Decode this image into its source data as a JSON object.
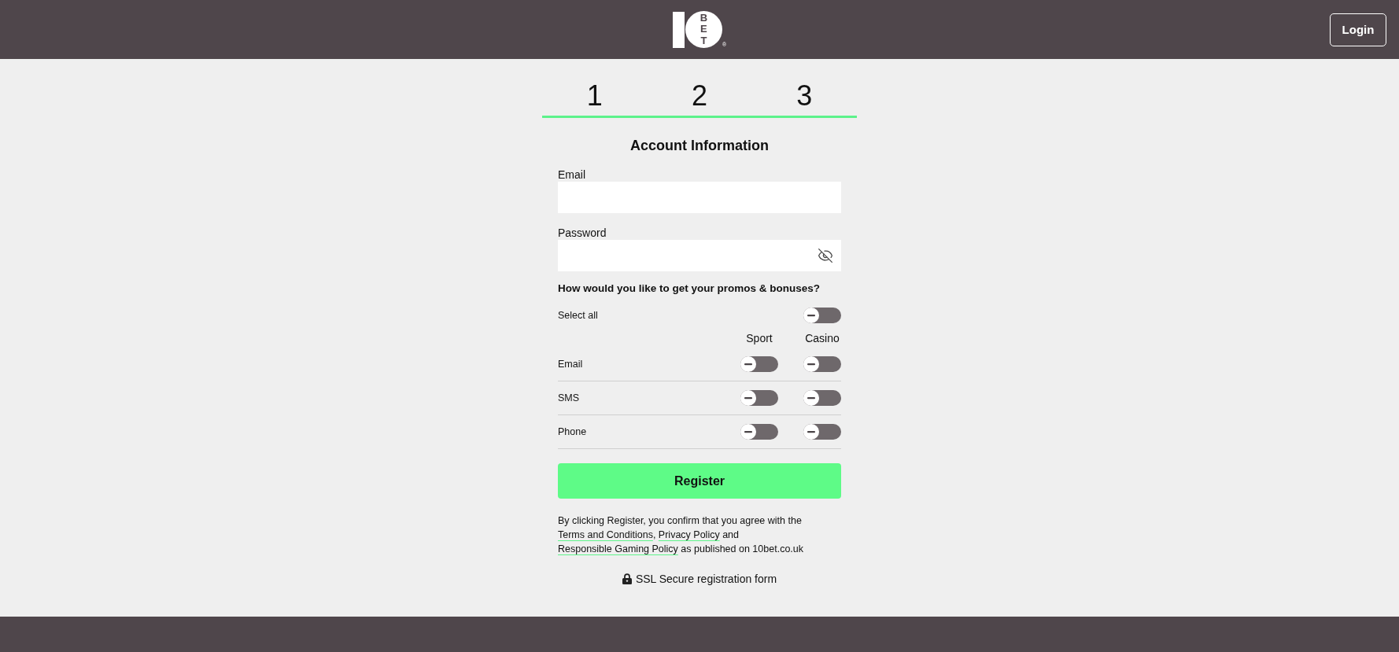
{
  "header": {
    "logo_letters": "BET",
    "registered_mark": "®",
    "login_button": "Login"
  },
  "steps": [
    "1",
    "2",
    "3"
  ],
  "form": {
    "title": "Account Information",
    "fields": [
      {
        "kind": "email",
        "label": "Email"
      },
      {
        "kind": "password",
        "label": "Password"
      }
    ]
  },
  "promos": {
    "question": "How would you like to get your promos & bonuses?",
    "select_all": {
      "label": "Select all",
      "on": false
    },
    "columns": [
      "Sport",
      "Casino"
    ],
    "rows": [
      {
        "label": "Email",
        "toggles": [
          {
            "on": false
          },
          {
            "on": false
          }
        ]
      },
      {
        "label": "SMS",
        "toggles": [
          {
            "on": false
          },
          {
            "on": false
          }
        ]
      },
      {
        "label": "Phone",
        "toggles": [
          {
            "on": false
          },
          {
            "on": false
          }
        ]
      }
    ]
  },
  "register_button": "Register",
  "terms": [
    {
      "kind": "text",
      "text": "By clicking Register, you confirm that you agree with the "
    },
    {
      "kind": "link",
      "text": "Terms and Conditions"
    },
    {
      "kind": "text",
      "text": ", "
    },
    {
      "kind": "link",
      "text": "Privacy Policy"
    },
    {
      "kind": "text",
      "text": " and "
    },
    {
      "kind": "link",
      "text": "Responsible Gaming Policy"
    },
    {
      "kind": "text",
      "text": " as published on 10bet.co.uk"
    }
  ],
  "ssl_note": "SSL Secure registration form"
}
